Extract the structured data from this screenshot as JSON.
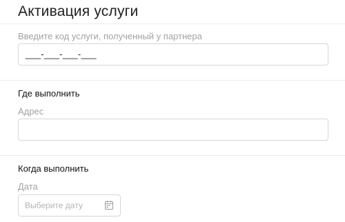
{
  "page": {
    "title": "Активация услуги"
  },
  "service_code": {
    "label": "Введите код услуги, полученный у партнера",
    "mask": "___-___-___-___"
  },
  "where": {
    "section_title": "Где выполнить",
    "address_label": "Адрес",
    "address_value": ""
  },
  "when": {
    "section_title": "Когда выполнить",
    "date_label": "Дата",
    "date_placeholder": "Выберите дату",
    "calendar_icon": "calendar-icon"
  },
  "colors": {
    "label_gray": "#a2a2a2",
    "border": "#d6d6d6",
    "divider": "#ececec"
  }
}
